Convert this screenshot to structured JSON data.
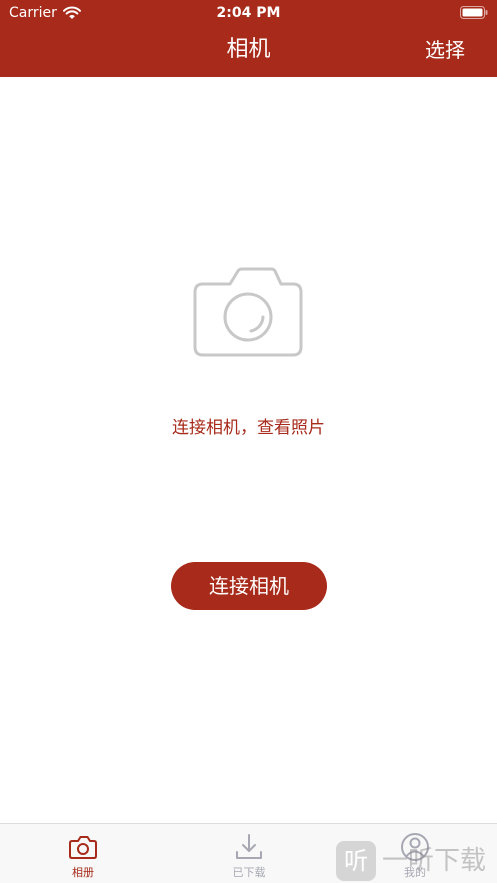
{
  "status_bar": {
    "carrier": "Carrier",
    "time": "2:04 PM",
    "wifi_icon": "wifi-icon",
    "battery_icon": "battery-icon"
  },
  "nav": {
    "title": "相机",
    "select_label": "选择"
  },
  "empty_state": {
    "icon": "camera-icon",
    "message": "连接相机，查看照片",
    "button_label": "连接相机"
  },
  "tabs": [
    {
      "label": "相册",
      "icon": "camera-icon",
      "active": true
    },
    {
      "label": "已下载",
      "icon": "download-icon",
      "active": false
    },
    {
      "label": "我的",
      "icon": "user-icon",
      "active": false
    }
  ],
  "watermark": {
    "badge": "听",
    "text": "一听下载"
  },
  "colors": {
    "accent": "#a72a1a",
    "tab_inactive": "#a8a8b4",
    "icon_gray": "#c8c8c8"
  }
}
